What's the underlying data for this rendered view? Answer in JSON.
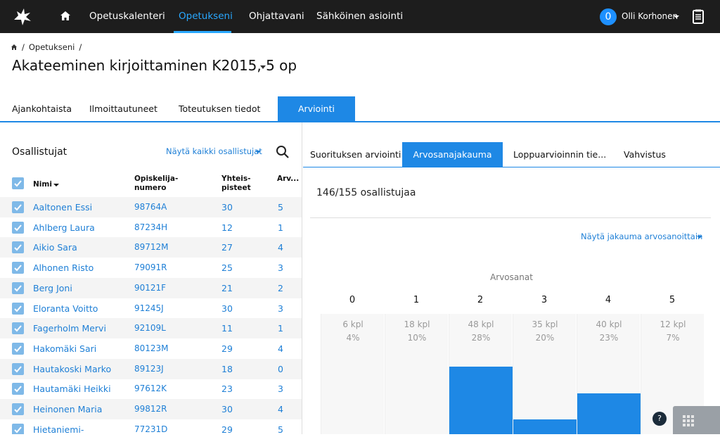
{
  "nav": {
    "items": [
      "Opetuskalenteri",
      "Opetukseni",
      "Ohjattavani",
      "Sähköinen asiointi"
    ],
    "active": "Opetukseni",
    "notification_count": "0",
    "user_name": "Olli Korhonen"
  },
  "breadcrumb": {
    "item": "Opetukseni",
    "sep": "/"
  },
  "course": {
    "title": "Akateeminen kirjoittaminen K2015, 5 op"
  },
  "tabs": [
    "Ajankohtaista",
    "Ilmoittautuneet",
    "Toteutuksen tiedot",
    "Arviointi"
  ],
  "participants": {
    "title": "Osallistujat",
    "filter": "Näytä kaikki osallistujat",
    "headers": {
      "name": "Nimi",
      "student_no": "Opiskelija-\nnumero",
      "points": "Yhteis-\npisteet",
      "grade": "Arv..."
    },
    "rows": [
      {
        "name": "Aaltonen Essi",
        "no": "98764A",
        "points": "30",
        "grade": "5"
      },
      {
        "name": "Ahlberg Laura",
        "no": "87234H",
        "points": "12",
        "grade": "1"
      },
      {
        "name": "Aikio Sara",
        "no": "89712M",
        "points": "27",
        "grade": "4"
      },
      {
        "name": "Alhonen Risto",
        "no": "79091R",
        "points": "25",
        "grade": "3"
      },
      {
        "name": "Berg Joni",
        "no": "90121F",
        "points": "21",
        "grade": "2"
      },
      {
        "name": "Eloranta Voitto",
        "no": "91245J",
        "points": "30",
        "grade": "3"
      },
      {
        "name": "Fagerholm Mervi",
        "no": "92109L",
        "points": "11",
        "grade": "1"
      },
      {
        "name": "Hakomäki Sari",
        "no": "80123M",
        "points": "29",
        "grade": "4"
      },
      {
        "name": "Hautakoski Marko",
        "no": "89123J",
        "points": "18",
        "grade": "0"
      },
      {
        "name": "Hautamäki Heikki",
        "no": "97612K",
        "points": "23",
        "grade": "3"
      },
      {
        "name": "Heinonen Maria",
        "no": "99812R",
        "points": "30",
        "grade": "4"
      },
      {
        "name": "Hietaniemi-",
        "no": "77231D",
        "points": "29",
        "grade": "5"
      }
    ]
  },
  "assessment": {
    "subtabs": [
      "Suorituksen arviointi",
      "Arvosanajakauma",
      "Loppuarvioinnin tie...",
      "Vahvistus"
    ],
    "active_subtab": "Arvosanajakauma",
    "count_text": "146/155 osallistujaa",
    "distribution_filter": "Näytä jakauma arvosanoittain",
    "grades_label": "Arvosanat"
  },
  "chart_data": {
    "type": "bar",
    "title": "",
    "xlabel": "Arvosanat",
    "categories": [
      "0",
      "1",
      "2",
      "3",
      "4",
      "5"
    ],
    "values": [
      6,
      18,
      48,
      35,
      40,
      12
    ],
    "count_labels": [
      "6 kpl",
      "18 kpl",
      "48 kpl",
      "35 kpl",
      "40 kpl",
      "12 kpl"
    ],
    "percent_labels": [
      "4%",
      "10%",
      "28%",
      "20%",
      "23%",
      "7%"
    ],
    "bar_fraction": [
      0,
      0,
      0.56,
      0.12,
      0.34,
      0
    ],
    "bar_color": "#1e88e5"
  },
  "help": {
    "label": "?"
  },
  "colors": {
    "accent": "#1e88e5",
    "topbar": "#1d1d1d",
    "link": "#1e7fd6"
  }
}
